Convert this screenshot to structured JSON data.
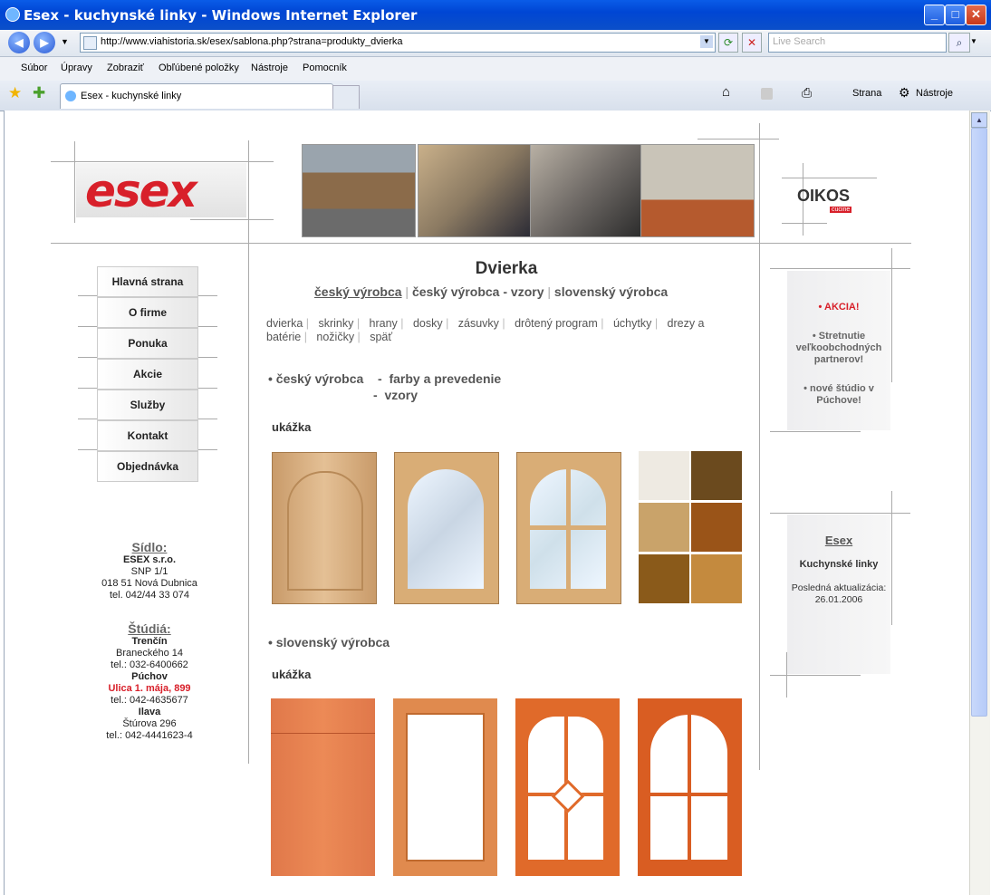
{
  "window": {
    "title": "Esex - kuchynské linky - Windows Internet Explorer"
  },
  "browser": {
    "url": "http://www.viahistoria.sk/esex/sablona.php?strana=produkty_dvierka",
    "search_placeholder": "Live Search",
    "menu": [
      "Súbor",
      "Úpravy",
      "Zobraziť",
      "Obľúbené položky",
      "Nástroje",
      "Pomocník"
    ],
    "tab_title": "Esex - kuchynské linky",
    "tools": {
      "page": "Strana",
      "tools": "Nástroje"
    }
  },
  "logos": {
    "esex": "esex",
    "oikos": "OIKOS",
    "oikos_sub": "cucine"
  },
  "nav": [
    "Hlavná strana",
    "O firme",
    "Ponuka",
    "Akcie",
    "Služby",
    "Kontakt",
    "Objednávka"
  ],
  "address": {
    "seat_heading": "Sídlo:",
    "seat_lines": [
      "ESEX s.r.o.",
      "SNP 1/1",
      "018 51 Nová Dubnica",
      "tel. 042/44 33 074"
    ],
    "studios_heading": "Štúdiá:",
    "studios": [
      {
        "city": "Trenčín",
        "street": "Braneckého 14",
        "tel": "tel.: 032-6400662"
      },
      {
        "city": "Púchov",
        "street": "Ulica 1. mája, 899",
        "tel": "tel.: 042-4635677"
      },
      {
        "city": "Ilava",
        "street": "Štúrova 296",
        "tel": "tel.: 042-4441623-4"
      }
    ]
  },
  "main": {
    "title": "Dvierka",
    "origin_tabs": [
      "český výrobca",
      "český výrobca - vzory",
      "slovenský výrobca"
    ],
    "categories": [
      "dvierka",
      "skrinky",
      "hrany",
      "dosky",
      "zásuvky",
      "drôtený program",
      "úchytky",
      "drezy a batérie",
      "nožičky",
      "späť"
    ],
    "czech_heading": "• český výrobca",
    "czech_link1": "-  farby a prevedenie",
    "czech_link2": "-  vzory",
    "sample_label": "ukážka",
    "slovak_heading": "• slovenský výrobca",
    "sample_label2": "ukážka"
  },
  "sidebar": {
    "news": [
      "• AKCIA!",
      "• Stretnutie veľkoobchodných partnerov!",
      "• nové štúdio v Púchove!"
    ],
    "box2_title": "Esex",
    "box2_sub": "Kuchynské linky",
    "box2_update_label": "Posledná aktualizácia:",
    "box2_update_date": "26.01.2006"
  },
  "colors": {
    "accent_red": "#d8202a",
    "title_blue": "#0b4fc9"
  }
}
